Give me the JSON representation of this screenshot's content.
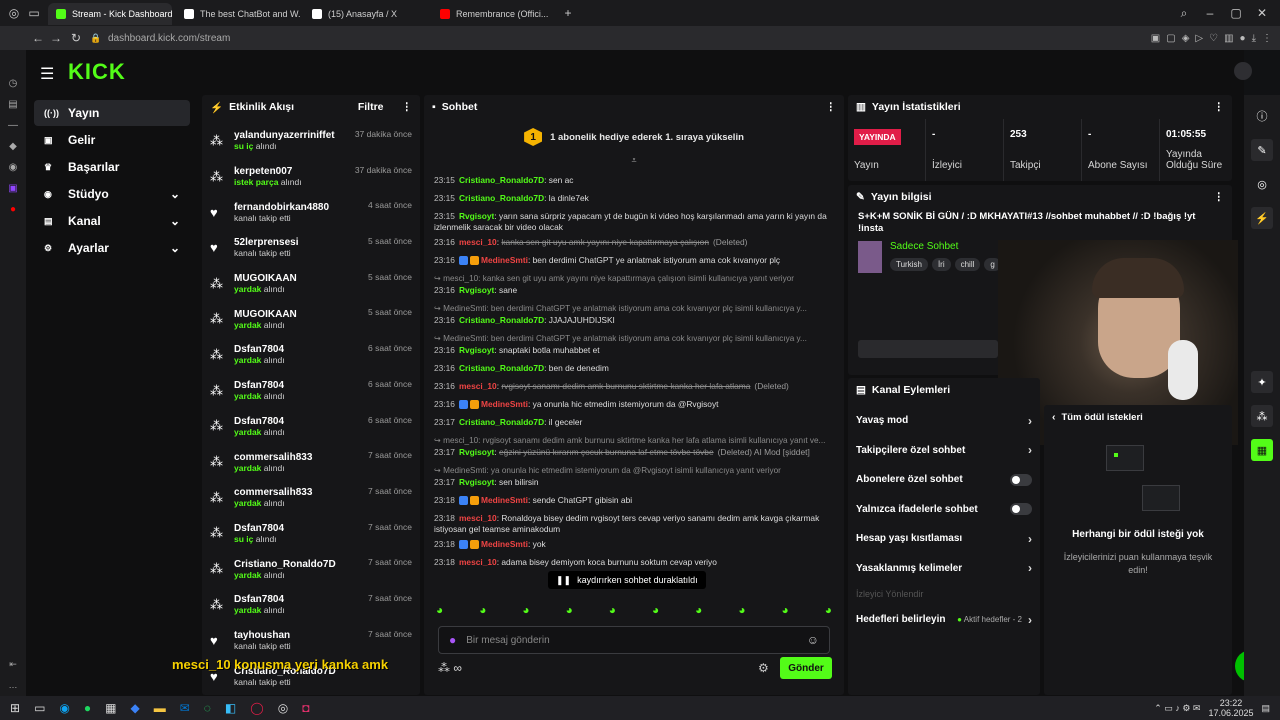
{
  "browser": {
    "tabs": [
      {
        "label": "Stream - Kick Dashboard",
        "color": "#53fc18",
        "active": true
      },
      {
        "label": "The best ChatBot and W...",
        "color": "#ffffff",
        "active": false
      },
      {
        "label": "(15) Anasayfa / X",
        "color": "#ffffff",
        "active": false
      },
      {
        "label": "Remembrance (Offici...",
        "color": "#ff0000",
        "active": false
      }
    ],
    "url": "dashboard.kick.com/stream"
  },
  "app": {
    "logo": "KICK",
    "sidebar": [
      {
        "label": "Yayın",
        "icon": "broadcast-icon",
        "active": true,
        "chev": false
      },
      {
        "label": "Gelir",
        "icon": "wallet-icon",
        "active": false,
        "chev": false
      },
      {
        "label": "Başarılar",
        "icon": "trophy-icon",
        "active": false,
        "chev": false
      },
      {
        "label": "Stüdyo",
        "icon": "studio-icon",
        "active": false,
        "chev": true
      },
      {
        "label": "Kanal",
        "icon": "channel-icon",
        "active": false,
        "chev": true
      },
      {
        "label": "Ayarlar",
        "icon": "settings-icon",
        "active": false,
        "chev": true
      }
    ],
    "activity": {
      "title": "Etkinlik Akışı",
      "filter": "Filtre",
      "items": [
        {
          "name": "yalandunyazerriniffet",
          "action_hl": "su iç",
          "action": " alındı",
          "time": "37 dakika önce",
          "icon": "gift-icon"
        },
        {
          "name": "kerpeten007",
          "action_hl": "istek parça",
          "action": " alındı",
          "time": "37 dakika önce",
          "icon": "gift-icon"
        },
        {
          "name": "fernandobirkan4880",
          "action_hl": "",
          "action": "kanalı takip etti",
          "time": "4 saat önce",
          "icon": "heart-icon"
        },
        {
          "name": "52lerprensesi",
          "action_hl": "",
          "action": "kanalı takip etti",
          "time": "5 saat önce",
          "icon": "heart-icon"
        },
        {
          "name": "MUGOIKAAN",
          "action_hl": "yardak",
          "action": " alındı",
          "time": "5 saat önce",
          "icon": "gift-icon"
        },
        {
          "name": "MUGOIKAAN",
          "action_hl": "yardak",
          "action": " alındı",
          "time": "5 saat önce",
          "icon": "gift-icon"
        },
        {
          "name": "Dsfan7804",
          "action_hl": "yardak",
          "action": " alındı",
          "time": "6 saat önce",
          "icon": "gift-icon"
        },
        {
          "name": "Dsfan7804",
          "action_hl": "yardak",
          "action": " alındı",
          "time": "6 saat önce",
          "icon": "gift-icon"
        },
        {
          "name": "Dsfan7804",
          "action_hl": "yardak",
          "action": " alındı",
          "time": "6 saat önce",
          "icon": "gift-icon"
        },
        {
          "name": "commersalih833",
          "action_hl": "yardak",
          "action": " alındı",
          "time": "7 saat önce",
          "icon": "gift-icon"
        },
        {
          "name": "commersalih833",
          "action_hl": "yardak",
          "action": " alındı",
          "time": "7 saat önce",
          "icon": "gift-icon"
        },
        {
          "name": "Dsfan7804",
          "action_hl": "su iç",
          "action": " alındı",
          "time": "7 saat önce",
          "icon": "gift-icon"
        },
        {
          "name": "Cristiano_Ronaldo7D",
          "action_hl": "yardak",
          "action": " alındı",
          "time": "7 saat önce",
          "icon": "gift-icon"
        },
        {
          "name": "Dsfan7804",
          "action_hl": "yardak",
          "action": " alındı",
          "time": "7 saat önce",
          "icon": "gift-icon"
        },
        {
          "name": "tayhoushan",
          "action_hl": "",
          "action": "kanalı takip etti",
          "time": "7 saat önce",
          "icon": "heart-icon"
        },
        {
          "name": "Cristiano_Ronaldo7D",
          "action_hl": "",
          "action": "kanalı takip etti",
          "time": "",
          "icon": "heart-icon"
        }
      ]
    },
    "chat": {
      "title": "Sohbet",
      "goal": "1 abonelik hediye ederek 1. sıraya yükselin",
      "goal_num": "1",
      "paused": "kaydırırken sohbet duraklatıldı",
      "input_placeholder": "Bir mesaj gönderin",
      "send": "Gönder",
      "footer_icon": "∞",
      "messages": [
        {
          "t": "23:15",
          "u": "Cristiano_Ronaldo7D",
          "uc": "green",
          "m": "sen ac"
        },
        {
          "t": "23:15",
          "u": "Cristiano_Ronaldo7D",
          "uc": "green",
          "m": "la dinle7ek"
        },
        {
          "t": "23:15",
          "u": "Rvgisoyt",
          "uc": "green",
          "m": "yarın sana sürpriz yapacam yt de bugün ki video hoş karşılanmadı ama yarın ki yayın da izlenmelik saracak bir video olacak"
        },
        {
          "t": "23:16",
          "u": "mesci_10",
          "uc": "red",
          "m": "kanka sen git uyu amk yayını niye kapattırmaya çalışıon",
          "del": true,
          "note": "(Deleted)"
        },
        {
          "t": "23:16",
          "u": "MedineSmti",
          "uc": "red",
          "m": "ben derdimi ChatGPT ye anlatmak istiyorum ama cok kıvanıyor plç",
          "badges": true
        },
        {
          "reply": "mesci_10: kanka sen git uyu amk yayını niye kapattırmaya çalışıon isimli kullanıcıya yanıt veriyor"
        },
        {
          "t": "23:16",
          "u": "Rvgisoyt",
          "uc": "green",
          "m": "sane"
        },
        {
          "reply": "MedineSmti: ben derdimi ChatGPT ye anlatmak istiyorum ama cok kıvanıyor plç isimli kullanıcıya y..."
        },
        {
          "t": "23:16",
          "u": "Cristiano_Ronaldo7D",
          "uc": "green",
          "m": "JJAJAJUHDIJSKI"
        },
        {
          "reply": "MedineSmti: ben derdimi ChatGPT ye anlatmak istiyorum ama cok kıvanıyor plç isimli kullanıcıya y..."
        },
        {
          "t": "23:16",
          "u": "Rvgisoyt",
          "uc": "green",
          "m": "snaptaki botla muhabbet et"
        },
        {
          "t": "23:16",
          "u": "Cristiano_Ronaldo7D",
          "uc": "green",
          "m": "ben de denedim"
        },
        {
          "t": "23:16",
          "u": "mesci_10",
          "uc": "red",
          "m": "rvgisoyt sanamı dedim amk burnunu sktirtme kanka her lafa atlama",
          "del": true,
          "note": "(Deleted)"
        },
        {
          "t": "23:16",
          "u": "MedineSmti",
          "uc": "red",
          "m": "ya onunla hic etmedim istemiyorum da @Rvgisoyt",
          "badges": true
        },
        {
          "t": "23:17",
          "u": "Cristiano_Ronaldo7D",
          "uc": "green",
          "m": "il geceler"
        },
        {
          "reply": "mesci_10: rvgisoyt sanamı dedim amk burnunu sktirtme kanka her lafa atlama isimli kullanıcıya yanıt ve..."
        },
        {
          "t": "23:17",
          "u": "Rvgisoyt",
          "uc": "green",
          "m": "eğzini yüzünü kırarım çocuk burnuna laf etme tövbe tövbe",
          "del": true,
          "note": "(Deleted)  AI Mod  [şiddet]"
        },
        {
          "reply": "MedineSmti: ya onunla hic etmedim istemiyorum da @Rvgisoyt isimli kullanıcıya yanıt veriyor"
        },
        {
          "t": "23:17",
          "u": "Rvgisoyt",
          "uc": "green",
          "m": "sen bilirsin"
        },
        {
          "t": "23:18",
          "u": "MedineSmti",
          "uc": "red",
          "m": "sende ChatGPT gibisin abi",
          "badges": true
        },
        {
          "t": "23:18",
          "u": "mesci_10",
          "uc": "red",
          "m": "Ronaldoya bisey dedim rvgisoyt ters cevap veriyo sanamı dedim amk kavga çıkarmak istiyosan gel teamse aminakodum"
        },
        {
          "t": "23:18",
          "u": "MedineSmti",
          "uc": "red",
          "m": "yok",
          "badges": true
        },
        {
          "t": "23:18",
          "u": "mesci_10",
          "uc": "red",
          "m": "adama bisey demiyom koca burnunu soktum cevap veriyo"
        }
      ]
    },
    "stats": {
      "title": "Yayın İstatistikleri",
      "live_label": "YAYINDA",
      "items": [
        {
          "value": "-",
          "label": "İzleyici"
        },
        {
          "value": "253",
          "label": "Takipçi"
        },
        {
          "value": "-",
          "label": "Abone Sayısı"
        },
        {
          "value": "01:05:55",
          "label": "Yayında Olduğu Süre"
        }
      ],
      "live_sub": "Yayın"
    },
    "info": {
      "title": "Yayın bilgisi",
      "stream_title": "S+K+M SONİK Bİ GÜN / :D MKHAYATI#13 //sohbet muhabbet // :D !bağış !yt !insta",
      "category": "Sadece Sohbet",
      "tags": [
        "Turkish",
        "İri",
        "chill",
        "g"
      ]
    },
    "actions": {
      "title": "Kanal Eylemleri",
      "items": [
        {
          "label": "Yavaş mod",
          "ctrl": "chev"
        },
        {
          "label": "Takipçilere özel sohbet",
          "ctrl": "chev"
        },
        {
          "label": "Abonelere özel sohbet",
          "ctrl": "toggle"
        },
        {
          "label": "Yalnızca ifadelerle sohbet",
          "ctrl": "toggle"
        },
        {
          "label": "Hesap yaşı kısıtlaması",
          "ctrl": "chev"
        },
        {
          "label": "Yasaklanmış kelimeler",
          "ctrl": "chev"
        }
      ],
      "viewer_director": "İzleyici Yönlendir",
      "goals_label": "Hedefleri belirleyin",
      "goals_status": "Aktif hedefler - 2"
    },
    "rewards": {
      "back": "Tüm ödül istekleri",
      "empty_title": "Herhangi bir ödül isteği yok",
      "empty_sub": "İzleyicilerinizi puan kullanmaya teşvik edin!"
    },
    "overlay_caption": "mesci_10 konusma yeri kanka amk"
  },
  "taskbar": {
    "time": "23:22",
    "date": "17.06.2025"
  },
  "colors": {
    "accent": "#53fc18",
    "live": "#e11d48",
    "red_user": "#ef4444"
  }
}
